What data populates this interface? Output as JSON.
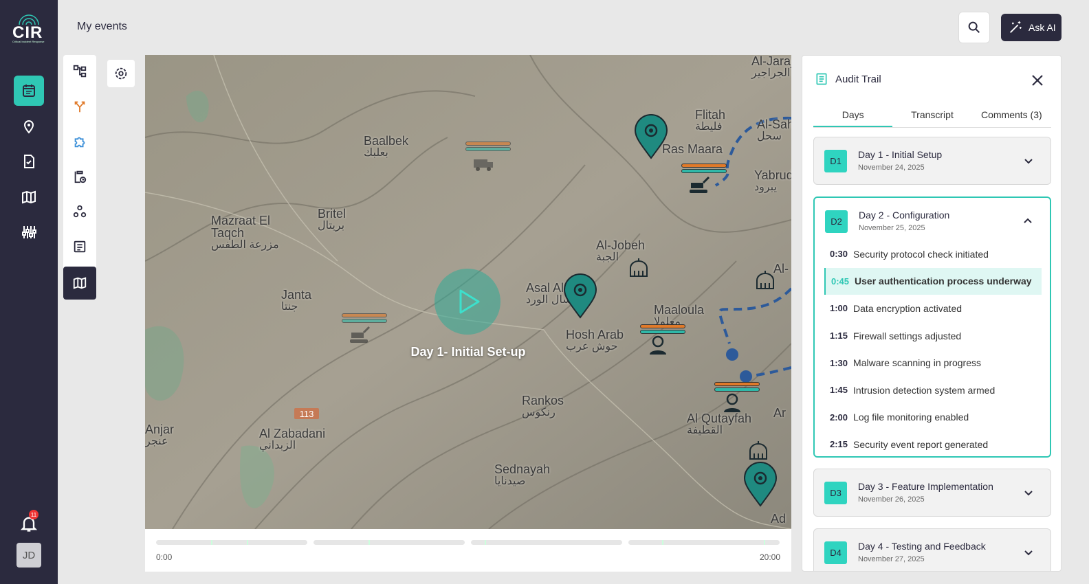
{
  "app": {
    "logo": "CIR",
    "logo_tagline": "Critical Incident Response",
    "notifications": "11",
    "user_initials": "JD"
  },
  "header": {
    "title": "My events",
    "ask_ai": "Ask AI"
  },
  "map": {
    "play_label": "Day 1- Initial Set-up",
    "places": [
      {
        "en": "Baalbek",
        "ar": "بعلبك"
      },
      {
        "en": "Flitah",
        "ar": "فليطة"
      },
      {
        "en": "Ras Maara",
        "ar": ""
      },
      {
        "en": "Britel",
        "ar": "بريتال"
      },
      {
        "en": "Mazraat El Taqch",
        "ar": "مزرعة الطفس"
      },
      {
        "en": "Al-Jobeh",
        "ar": "الجبة"
      },
      {
        "en": "Asal Al Ward",
        "ar": "عسال الورد"
      },
      {
        "en": "Janta",
        "ar": "جنتا"
      },
      {
        "en": "Maaloula",
        "ar": "معلولا"
      },
      {
        "en": "Hosh Arab",
        "ar": "حوش عرب"
      },
      {
        "en": "Rankos",
        "ar": "رنكوس"
      },
      {
        "en": "Al Zabadani",
        "ar": "الزبداني"
      },
      {
        "en": "Al Qutayfah",
        "ar": "القطيفة"
      },
      {
        "en": "Sednayah",
        "ar": "صيدنايا"
      },
      {
        "en": "Yabrud",
        "ar": "يبرود"
      },
      {
        "en": "Al-Jarajir",
        "ar": "الجراجير"
      },
      {
        "en": "Al-Sahel",
        "ar": "سحل"
      },
      {
        "en": "Anjar",
        "ar": "عنجر"
      },
      {
        "en": "Ad",
        "ar": ""
      },
      {
        "en": "Ar",
        "ar": ""
      },
      {
        "en": "Al-",
        "ar": ""
      }
    ],
    "road_label": "113"
  },
  "timeline": {
    "start": "0:00",
    "end": "20:00"
  },
  "audit": {
    "title": "Audit Trail",
    "tabs": [
      "Days",
      "Transcript",
      "Comments (3)"
    ],
    "days": [
      {
        "badge": "D1",
        "title": "Day 1 - Initial Setup",
        "date": "November 24, 2025"
      },
      {
        "badge": "D2",
        "title": "Day 2 - Configuration",
        "date": "November 25, 2025",
        "entries": [
          {
            "time": "0:30",
            "text": "Security protocol check initiated"
          },
          {
            "time": "0:45",
            "text": "User authentication process underway"
          },
          {
            "time": "1:00",
            "text": "Data encryption activated"
          },
          {
            "time": "1:15",
            "text": "Firewall settings adjusted"
          },
          {
            "time": "1:30",
            "text": "Malware scanning in progress"
          },
          {
            "time": "1:45",
            "text": "Intrusion detection system armed"
          },
          {
            "time": "2:00",
            "text": "Log file monitoring enabled"
          },
          {
            "time": "2:15",
            "text": "Security event report generated"
          }
        ]
      },
      {
        "badge": "D3",
        "title": "Day 3 - Feature Implementation",
        "date": "November 26, 2025"
      },
      {
        "badge": "D4",
        "title": "Day 4 - Testing and Feedback",
        "date": "November 27, 2025"
      }
    ]
  },
  "colors": {
    "nav": "#2b2a3e",
    "accent": "#2fc7b4",
    "orange": "#e07a2a"
  }
}
